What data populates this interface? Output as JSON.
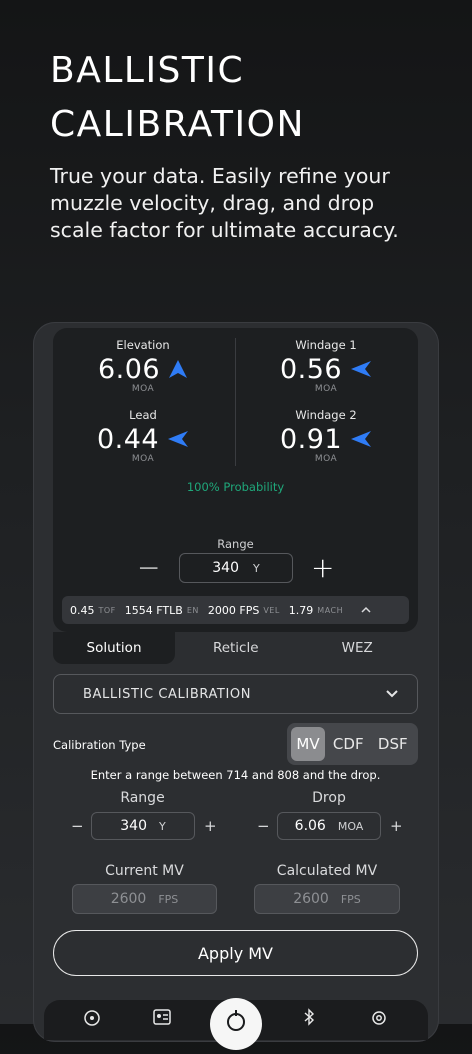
{
  "hero": {
    "title_line1": "BALLISTIC",
    "title_line2": "CALIBRATION",
    "subtitle": "True your data. Easily refine your muzzle velocity, drag, and drop scale factor for ultimate accuracy."
  },
  "solution": {
    "elevation": {
      "label": "Elevation",
      "value": "6.06",
      "unit": "MOA",
      "icon": "arrow-up-icon"
    },
    "windage1": {
      "label": "Windage 1",
      "value": "0.56",
      "unit": "MOA",
      "icon": "arrow-left-icon"
    },
    "lead": {
      "label": "Lead",
      "value": "0.44",
      "unit": "MOA",
      "icon": "arrow-left-icon"
    },
    "windage2": {
      "label": "Windage 2",
      "value": "0.91",
      "unit": "MOA",
      "icon": "arrow-left-icon"
    },
    "probability": "100% Probability",
    "range_label": "Range",
    "range_value": "340",
    "range_unit": "Y",
    "minus": "−",
    "plus": "+",
    "stats": [
      {
        "value": "0.45",
        "label": "TOF"
      },
      {
        "value": "1554 FTLB",
        "label": "EN"
      },
      {
        "value": "2000 FPS",
        "label": "VEL"
      },
      {
        "value": "1.79",
        "label": "MACH"
      }
    ],
    "collapse_glyph": "⌃"
  },
  "tabs": [
    {
      "label": "Solution",
      "active": true
    },
    {
      "label": "Reticle",
      "active": false
    },
    {
      "label": "WEZ",
      "active": false
    }
  ],
  "calibration": {
    "dropdown_value": "BALLISTIC CALIBRATION",
    "type_label": "Calibration Type",
    "types": [
      "MV",
      "CDF",
      "DSF"
    ],
    "selected_type": "MV",
    "instruction": "Enter a range between 714 and 808 and the drop.",
    "range": {
      "label": "Range",
      "value": "340",
      "unit": "Y"
    },
    "drop": {
      "label": "Drop",
      "value": "6.06",
      "unit": "MOA"
    },
    "current_mv": {
      "label": "Current MV",
      "value": "2600",
      "unit": "FPS"
    },
    "calculated_mv": {
      "label": "Calculated MV",
      "value": "2600",
      "unit": "FPS"
    },
    "minus": "−",
    "plus": "+",
    "apply_label": "Apply MV"
  },
  "colors": {
    "accent": "#2f7cf6",
    "probability": "#1fa77a"
  }
}
